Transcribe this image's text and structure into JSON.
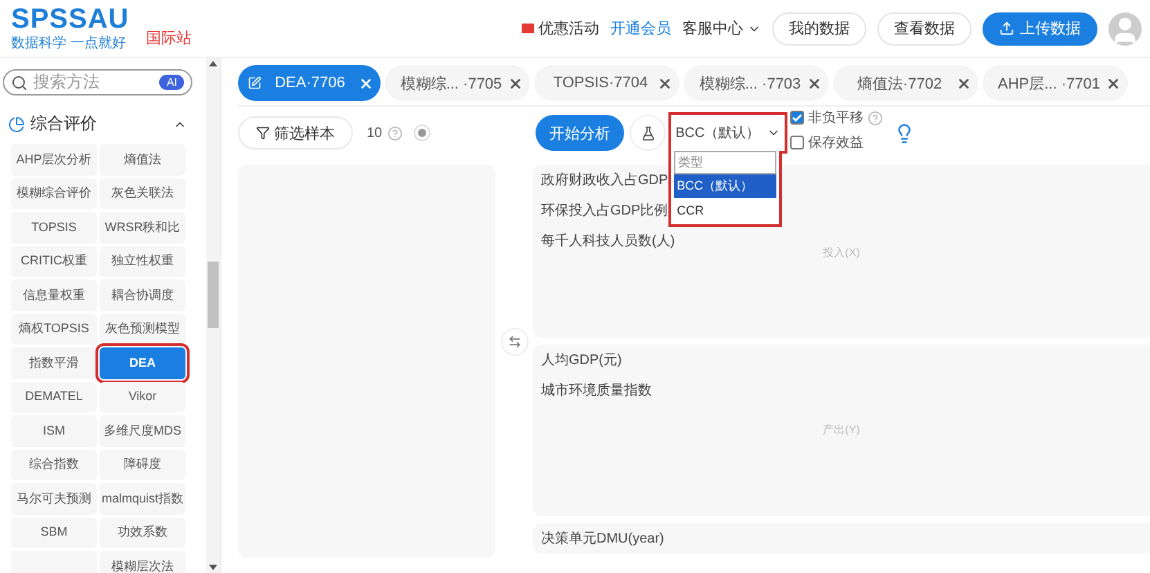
{
  "header": {
    "logo": "SPSSAU",
    "slogan": "数据科学 一点就好",
    "intl_link": "国际站",
    "promo": "优惠活动",
    "vip": "开通会员",
    "service": "客服中心",
    "buttons": [
      {
        "label": "我的数据",
        "kind": "plain"
      },
      {
        "label": "查看数据",
        "kind": "plain"
      },
      {
        "label": "上传数据",
        "kind": "primary"
      }
    ]
  },
  "sidebar": {
    "search": {
      "placeholder": "搜索方法",
      "badge": "AI"
    },
    "section": {
      "title": "综合评价",
      "expanded": true
    },
    "items": [
      {
        "label": "AHP层次分析",
        "selected": false
      },
      {
        "label": "熵值法",
        "selected": false
      },
      {
        "label": "模糊综合评价",
        "selected": false
      },
      {
        "label": "灰色关联法",
        "selected": false
      },
      {
        "label": "TOPSIS",
        "selected": false
      },
      {
        "label": "WRSR秩和比",
        "selected": false
      },
      {
        "label": "CRITIC权重",
        "selected": false
      },
      {
        "label": "独立性权重",
        "selected": false
      },
      {
        "label": "信息量权重",
        "selected": false
      },
      {
        "label": "耦合协调度",
        "selected": false
      },
      {
        "label": "熵权TOPSIS",
        "selected": false
      },
      {
        "label": "灰色预测模型",
        "selected": false
      },
      {
        "label": "指数平滑",
        "selected": false
      },
      {
        "label": "DEA",
        "selected": true
      },
      {
        "label": "DEMATEL",
        "selected": false
      },
      {
        "label": "Vikor",
        "selected": false
      },
      {
        "label": "ISM",
        "selected": false
      },
      {
        "label": "多维尺度MDS",
        "selected": false
      },
      {
        "label": "综合指数",
        "selected": false
      },
      {
        "label": "障碍度",
        "selected": false
      },
      {
        "label": "马尔可夫预测",
        "selected": false
      },
      {
        "label": "malmquist指数",
        "selected": false
      },
      {
        "label": "SBM",
        "selected": false
      },
      {
        "label": "功效系数",
        "selected": false
      },
      {
        "selected": false
      },
      {
        "label": "模糊层次法",
        "selected": false
      }
    ]
  },
  "tabs": [
    {
      "label": "DEA·7706",
      "selected": true
    },
    {
      "label": "模糊综... ·7705",
      "selected": false
    },
    {
      "label": "TOPSIS·7704",
      "selected": false
    },
    {
      "label": "模糊综... ·7703",
      "selected": false
    },
    {
      "label": "熵值法·7702",
      "selected": false
    },
    {
      "label": "AHP层... ·7701",
      "selected": false
    }
  ],
  "toolbar": {
    "filter": "筛选样本",
    "count": "10",
    "run": "开始分析",
    "select": {
      "value": "BCC（默认）",
      "expanded": true,
      "options": [
        {
          "label": "类型",
          "selected": false
        },
        {
          "label": "BCC（默认）",
          "selected": true
        },
        {
          "label": "CCR",
          "selected": false
        }
      ]
    },
    "checks": [
      {
        "label": "非负平移",
        "checked": true
      },
      {
        "label": "保存效益",
        "checked": false
      }
    ]
  },
  "inputs": {
    "items": [
      "政府财政收入占GDP",
      "环保投入占GDP比例",
      "每千人科技人员数(人)"
    ],
    "placeholder": "投入(X)"
  },
  "outputs": {
    "items": [
      "人均GDP(元)",
      "城市环境质量指数"
    ],
    "placeholder": "产出(Y)"
  },
  "dmu": {
    "items": [
      "决策单元DMU(year)"
    ]
  }
}
